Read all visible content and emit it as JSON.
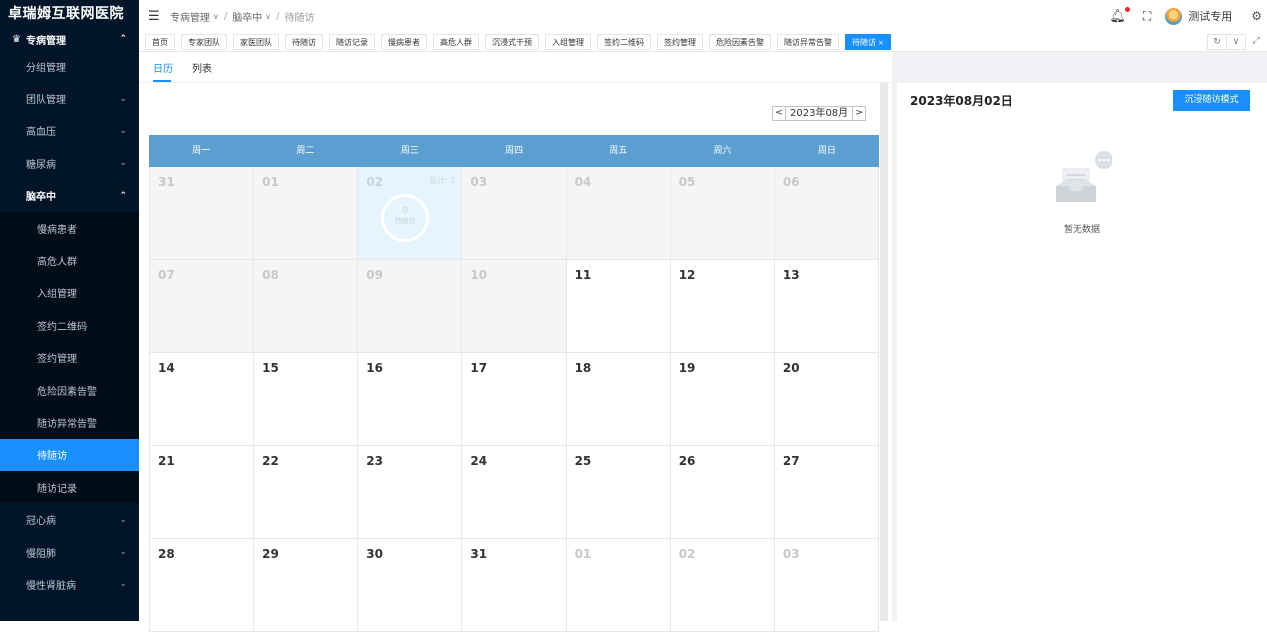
{
  "sidebar": {
    "title": "卓瑞姆互联网医院",
    "dept": "专病管理",
    "items": [
      {
        "label": "分组管理",
        "type": "item"
      },
      {
        "label": "团队管理",
        "type": "group"
      },
      {
        "label": "高血压",
        "type": "group"
      },
      {
        "label": "糖尿病",
        "type": "group"
      },
      {
        "label": "脑卒中",
        "type": "open"
      },
      {
        "label": "慢病患者",
        "type": "sub"
      },
      {
        "label": "高危人群",
        "type": "sub"
      },
      {
        "label": "入组管理",
        "type": "sub"
      },
      {
        "label": "签约二维码",
        "type": "sub"
      },
      {
        "label": "签约管理",
        "type": "sub"
      },
      {
        "label": "危险因素告警",
        "type": "sub"
      },
      {
        "label": "随访异常告警",
        "type": "sub"
      },
      {
        "label": "待随访",
        "type": "active"
      },
      {
        "label": "随访记录",
        "type": "sub"
      },
      {
        "label": "冠心病",
        "type": "group"
      },
      {
        "label": "慢阻肺",
        "type": "group"
      },
      {
        "label": "慢性肾脏病",
        "type": "group"
      }
    ]
  },
  "header": {
    "breadcrumb": [
      "专病管理",
      "脑卒中",
      "待随访"
    ],
    "username": "测试专用"
  },
  "tabs": [
    "首页",
    "专家团队",
    "家医团队",
    "待随访",
    "随访记录",
    "慢病患者",
    "高危人群",
    "沉浸式干预",
    "入组管理",
    "签约二维码",
    "签约管理",
    "危险因素告警",
    "随访异常告警",
    "待随访"
  ],
  "active_tab_index": 13,
  "view_tabs": [
    "日历",
    "列表"
  ],
  "calendar": {
    "month_label": "2023年08月",
    "weekdays": [
      "周一",
      "周二",
      "周三",
      "周四",
      "周五",
      "周六",
      "周日"
    ],
    "weeks": [
      [
        {
          "d": "31",
          "s": "muted"
        },
        {
          "d": "01",
          "s": "muted"
        },
        {
          "d": "02",
          "s": "sel",
          "total": "总计: 1",
          "count": "0",
          "label": "待随访"
        },
        {
          "d": "03",
          "s": "muted"
        },
        {
          "d": "04",
          "s": "muted"
        },
        {
          "d": "05",
          "s": "muted"
        },
        {
          "d": "06",
          "s": "muted"
        }
      ],
      [
        {
          "d": "07",
          "s": "muted"
        },
        {
          "d": "08",
          "s": "muted"
        },
        {
          "d": "09",
          "s": "muted"
        },
        {
          "d": "10",
          "s": "muted"
        },
        {
          "d": "11",
          "s": ""
        },
        {
          "d": "12",
          "s": ""
        },
        {
          "d": "13",
          "s": ""
        }
      ],
      [
        {
          "d": "14",
          "s": ""
        },
        {
          "d": "15",
          "s": ""
        },
        {
          "d": "16",
          "s": ""
        },
        {
          "d": "17",
          "s": ""
        },
        {
          "d": "18",
          "s": ""
        },
        {
          "d": "19",
          "s": ""
        },
        {
          "d": "20",
          "s": ""
        }
      ],
      [
        {
          "d": "21",
          "s": ""
        },
        {
          "d": "22",
          "s": ""
        },
        {
          "d": "23",
          "s": ""
        },
        {
          "d": "24",
          "s": ""
        },
        {
          "d": "25",
          "s": ""
        },
        {
          "d": "26",
          "s": ""
        },
        {
          "d": "27",
          "s": ""
        }
      ],
      [
        {
          "d": "28",
          "s": ""
        },
        {
          "d": "29",
          "s": ""
        },
        {
          "d": "30",
          "s": ""
        },
        {
          "d": "31",
          "s": ""
        },
        {
          "d": "01",
          "s": "other"
        },
        {
          "d": "02",
          "s": "other"
        },
        {
          "d": "03",
          "s": "other"
        }
      ]
    ]
  },
  "detail": {
    "date": "2023年08月02日",
    "button": "沉浸随访模式",
    "empty_text": "暂无数据"
  },
  "colors": {
    "accent": "#1890ff",
    "sidebar_bg": "#001529",
    "calendar_header": "#5b9fd0"
  }
}
